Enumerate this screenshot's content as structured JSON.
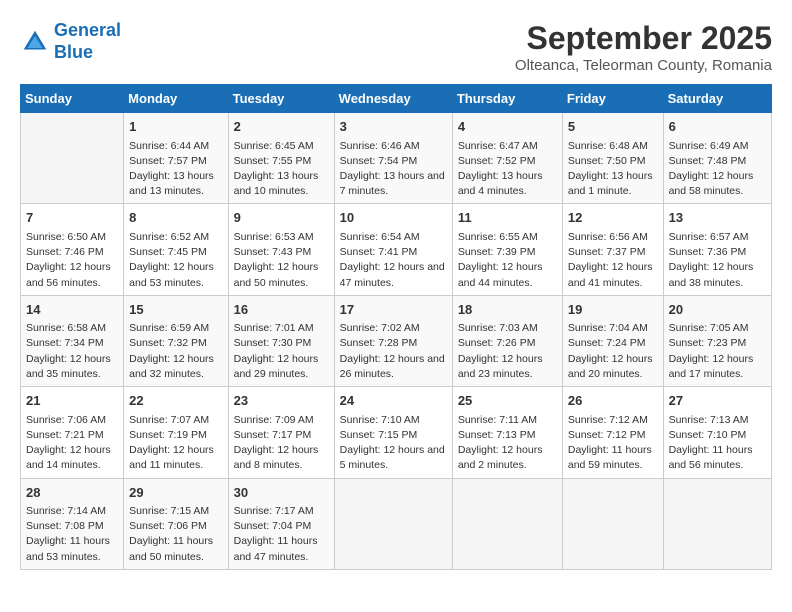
{
  "logo": {
    "line1": "General",
    "line2": "Blue"
  },
  "title": "September 2025",
  "location": "Olteanca, Teleorman County, Romania",
  "days_of_week": [
    "Sunday",
    "Monday",
    "Tuesday",
    "Wednesday",
    "Thursday",
    "Friday",
    "Saturday"
  ],
  "weeks": [
    [
      {
        "num": "",
        "empty": true
      },
      {
        "num": "1",
        "sunrise": "Sunrise: 6:44 AM",
        "sunset": "Sunset: 7:57 PM",
        "daylight": "Daylight: 13 hours and 13 minutes."
      },
      {
        "num": "2",
        "sunrise": "Sunrise: 6:45 AM",
        "sunset": "Sunset: 7:55 PM",
        "daylight": "Daylight: 13 hours and 10 minutes."
      },
      {
        "num": "3",
        "sunrise": "Sunrise: 6:46 AM",
        "sunset": "Sunset: 7:54 PM",
        "daylight": "Daylight: 13 hours and 7 minutes."
      },
      {
        "num": "4",
        "sunrise": "Sunrise: 6:47 AM",
        "sunset": "Sunset: 7:52 PM",
        "daylight": "Daylight: 13 hours and 4 minutes."
      },
      {
        "num": "5",
        "sunrise": "Sunrise: 6:48 AM",
        "sunset": "Sunset: 7:50 PM",
        "daylight": "Daylight: 13 hours and 1 minute."
      },
      {
        "num": "6",
        "sunrise": "Sunrise: 6:49 AM",
        "sunset": "Sunset: 7:48 PM",
        "daylight": "Daylight: 12 hours and 58 minutes."
      }
    ],
    [
      {
        "num": "7",
        "sunrise": "Sunrise: 6:50 AM",
        "sunset": "Sunset: 7:46 PM",
        "daylight": "Daylight: 12 hours and 56 minutes."
      },
      {
        "num": "8",
        "sunrise": "Sunrise: 6:52 AM",
        "sunset": "Sunset: 7:45 PM",
        "daylight": "Daylight: 12 hours and 53 minutes."
      },
      {
        "num": "9",
        "sunrise": "Sunrise: 6:53 AM",
        "sunset": "Sunset: 7:43 PM",
        "daylight": "Daylight: 12 hours and 50 minutes."
      },
      {
        "num": "10",
        "sunrise": "Sunrise: 6:54 AM",
        "sunset": "Sunset: 7:41 PM",
        "daylight": "Daylight: 12 hours and 47 minutes."
      },
      {
        "num": "11",
        "sunrise": "Sunrise: 6:55 AM",
        "sunset": "Sunset: 7:39 PM",
        "daylight": "Daylight: 12 hours and 44 minutes."
      },
      {
        "num": "12",
        "sunrise": "Sunrise: 6:56 AM",
        "sunset": "Sunset: 7:37 PM",
        "daylight": "Daylight: 12 hours and 41 minutes."
      },
      {
        "num": "13",
        "sunrise": "Sunrise: 6:57 AM",
        "sunset": "Sunset: 7:36 PM",
        "daylight": "Daylight: 12 hours and 38 minutes."
      }
    ],
    [
      {
        "num": "14",
        "sunrise": "Sunrise: 6:58 AM",
        "sunset": "Sunset: 7:34 PM",
        "daylight": "Daylight: 12 hours and 35 minutes."
      },
      {
        "num": "15",
        "sunrise": "Sunrise: 6:59 AM",
        "sunset": "Sunset: 7:32 PM",
        "daylight": "Daylight: 12 hours and 32 minutes."
      },
      {
        "num": "16",
        "sunrise": "Sunrise: 7:01 AM",
        "sunset": "Sunset: 7:30 PM",
        "daylight": "Daylight: 12 hours and 29 minutes."
      },
      {
        "num": "17",
        "sunrise": "Sunrise: 7:02 AM",
        "sunset": "Sunset: 7:28 PM",
        "daylight": "Daylight: 12 hours and 26 minutes."
      },
      {
        "num": "18",
        "sunrise": "Sunrise: 7:03 AM",
        "sunset": "Sunset: 7:26 PM",
        "daylight": "Daylight: 12 hours and 23 minutes."
      },
      {
        "num": "19",
        "sunrise": "Sunrise: 7:04 AM",
        "sunset": "Sunset: 7:24 PM",
        "daylight": "Daylight: 12 hours and 20 minutes."
      },
      {
        "num": "20",
        "sunrise": "Sunrise: 7:05 AM",
        "sunset": "Sunset: 7:23 PM",
        "daylight": "Daylight: 12 hours and 17 minutes."
      }
    ],
    [
      {
        "num": "21",
        "sunrise": "Sunrise: 7:06 AM",
        "sunset": "Sunset: 7:21 PM",
        "daylight": "Daylight: 12 hours and 14 minutes."
      },
      {
        "num": "22",
        "sunrise": "Sunrise: 7:07 AM",
        "sunset": "Sunset: 7:19 PM",
        "daylight": "Daylight: 12 hours and 11 minutes."
      },
      {
        "num": "23",
        "sunrise": "Sunrise: 7:09 AM",
        "sunset": "Sunset: 7:17 PM",
        "daylight": "Daylight: 12 hours and 8 minutes."
      },
      {
        "num": "24",
        "sunrise": "Sunrise: 7:10 AM",
        "sunset": "Sunset: 7:15 PM",
        "daylight": "Daylight: 12 hours and 5 minutes."
      },
      {
        "num": "25",
        "sunrise": "Sunrise: 7:11 AM",
        "sunset": "Sunset: 7:13 PM",
        "daylight": "Daylight: 12 hours and 2 minutes."
      },
      {
        "num": "26",
        "sunrise": "Sunrise: 7:12 AM",
        "sunset": "Sunset: 7:12 PM",
        "daylight": "Daylight: 11 hours and 59 minutes."
      },
      {
        "num": "27",
        "sunrise": "Sunrise: 7:13 AM",
        "sunset": "Sunset: 7:10 PM",
        "daylight": "Daylight: 11 hours and 56 minutes."
      }
    ],
    [
      {
        "num": "28",
        "sunrise": "Sunrise: 7:14 AM",
        "sunset": "Sunset: 7:08 PM",
        "daylight": "Daylight: 11 hours and 53 minutes."
      },
      {
        "num": "29",
        "sunrise": "Sunrise: 7:15 AM",
        "sunset": "Sunset: 7:06 PM",
        "daylight": "Daylight: 11 hours and 50 minutes."
      },
      {
        "num": "30",
        "sunrise": "Sunrise: 7:17 AM",
        "sunset": "Sunset: 7:04 PM",
        "daylight": "Daylight: 11 hours and 47 minutes."
      },
      {
        "num": "",
        "empty": true
      },
      {
        "num": "",
        "empty": true
      },
      {
        "num": "",
        "empty": true
      },
      {
        "num": "",
        "empty": true
      }
    ]
  ]
}
